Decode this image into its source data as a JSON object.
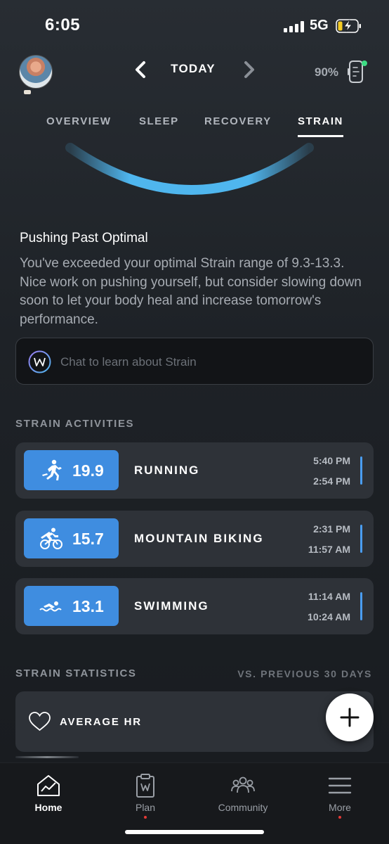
{
  "status_bar": {
    "time": "6:05",
    "network": "5G"
  },
  "header": {
    "title": "TODAY",
    "device_battery": "90%"
  },
  "tabs": [
    {
      "label": "OVERVIEW",
      "active": false
    },
    {
      "label": "SLEEP",
      "active": false
    },
    {
      "label": "RECOVERY",
      "active": false
    },
    {
      "label": "STRAIN",
      "active": true
    }
  ],
  "summary": {
    "headline": "Pushing Past Optimal",
    "description": "You've exceeded your optimal Strain range of 9.3-13.3. Nice work on pushing yourself, but consider slowing down soon to let your body heal and increase tomorrow's performance."
  },
  "chat": {
    "placeholder": "Chat to learn about Strain"
  },
  "strain_activities": {
    "label": "STRAIN ACTIVITIES",
    "items": [
      {
        "icon": "running-icon",
        "strain": "19.9",
        "name": "RUNNING",
        "start": "5:40 PM",
        "end": "2:54 PM"
      },
      {
        "icon": "mountain-biking-icon",
        "strain": "15.7",
        "name": "MOUNTAIN BIKING",
        "start": "2:31 PM",
        "end": "11:57 AM"
      },
      {
        "icon": "swimming-icon",
        "strain": "13.1",
        "name": "SWIMMING",
        "start": "11:14 AM",
        "end": "10:24 AM"
      }
    ]
  },
  "strain_statistics": {
    "label": "STRAIN STATISTICS",
    "comparison": "VS. PREVIOUS 30 DAYS",
    "items": [
      {
        "icon": "heart-icon",
        "label": "AVERAGE HR"
      }
    ]
  },
  "bottom_nav": [
    {
      "label": "Home",
      "icon": "home-icon",
      "active": true
    },
    {
      "label": "Plan",
      "icon": "plan-icon",
      "active": false
    },
    {
      "label": "Community",
      "icon": "community-icon",
      "active": false
    },
    {
      "label": "More",
      "icon": "menu-icon",
      "active": false
    }
  ],
  "colors": {
    "accent_blue": "#3f8de0",
    "gauge_blue": "#4fb6ee",
    "notification_dot": "#e53935"
  }
}
